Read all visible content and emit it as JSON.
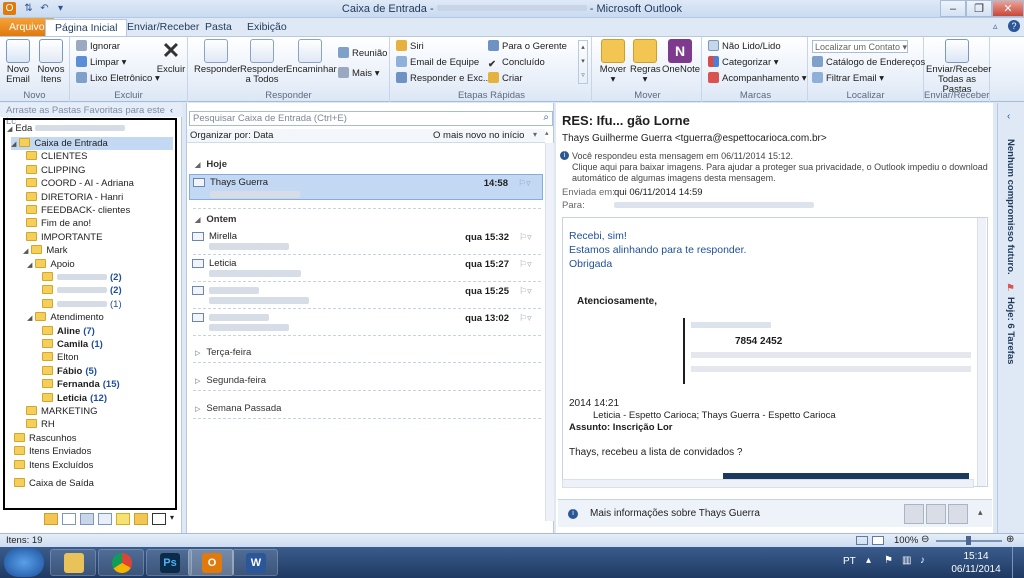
{
  "window": {
    "title_prefix": "Caixa de Entrada - ",
    "title_suffix": " - Microsoft Outlook"
  },
  "tabs": [
    "Arquivo",
    "Página Inicial",
    "Enviar/Receber",
    "Pasta",
    "Exibição"
  ],
  "ribbon": {
    "novo": {
      "label": "Novo",
      "novo_email": "Novo Email",
      "novos_itens": "Novos Itens"
    },
    "excluir": {
      "label": "Excluir",
      "ignorar": "Ignorar",
      "limpar": "Limpar",
      "lixo": "Lixo Eletrônico",
      "excluir_btn": "Excluir"
    },
    "responder": {
      "label": "Responder",
      "responder": "Responder",
      "responder_todos": "Responder a Todos",
      "encaminhar": "Encaminhar",
      "reuniao": "Reunião",
      "mais": "Mais"
    },
    "etapas": {
      "label": "Etapas Rápidas",
      "siri": "Siri",
      "equipe": "Email de Equipe",
      "resp_exc": "Responder e Exc...",
      "para_gerente": "Para o Gerente",
      "concluido": "Concluído",
      "criar": "Criar"
    },
    "mover": {
      "label": "Mover",
      "mover": "Mover",
      "regras": "Regras",
      "onenote": "OneNote"
    },
    "marcas": {
      "label": "Marcas",
      "nao_lido": "Não Lido/Lido",
      "categorizar": "Categorizar",
      "acompanhamento": "Acompanhamento"
    },
    "localizar": {
      "label": "Localizar",
      "contato_placeholder": "Localizar um Contato",
      "catalogo": "Catálogo de Endereços",
      "filtrar": "Filtrar Email"
    },
    "envrec": {
      "label": "Enviar/Receber",
      "btn": "Enviar/Receber Todas as Pastas"
    }
  },
  "nav": {
    "fav_hint": "Arraste as Pastas Favoritas para este Lc",
    "account": "Eda",
    "folders": [
      {
        "name": "Caixa de Entrada",
        "count": "",
        "level": 1,
        "bold": false,
        "selected": true
      },
      {
        "name": "CLIENTES",
        "count": "",
        "level": 2
      },
      {
        "name": "CLIPPING",
        "count": "",
        "level": 2
      },
      {
        "name": "COORD - AI - Adriana",
        "count": "",
        "level": 2
      },
      {
        "name": "DIRETORIA - Hanri",
        "count": "",
        "level": 2
      },
      {
        "name": "FEEDBACK- clientes",
        "count": "",
        "level": 2
      },
      {
        "name": "Fim de ano!",
        "count": "",
        "level": 2
      },
      {
        "name": "IMPORTANTE",
        "count": "",
        "level": 2
      },
      {
        "name": "Mark",
        "count": "",
        "level": 2
      },
      {
        "name": "Apoio",
        "count": "",
        "level": 3
      },
      {
        "name": "",
        "count": "(2)",
        "level": 4,
        "bold": true
      },
      {
        "name": "",
        "count": "(2)",
        "level": 4,
        "bold": true
      },
      {
        "name": "",
        "count": "(1)",
        "level": 4
      },
      {
        "name": "Atendimento",
        "count": "",
        "level": 3
      },
      {
        "name": "Aline",
        "count": "(7)",
        "level": 4,
        "bold": true
      },
      {
        "name": "Camila",
        "count": "(1)",
        "level": 4,
        "bold": true
      },
      {
        "name": "Elton",
        "count": "",
        "level": 4
      },
      {
        "name": "Fábio",
        "count": "(5)",
        "level": 4,
        "bold": true
      },
      {
        "name": "Fernanda",
        "count": "(15)",
        "level": 4,
        "bold": true
      },
      {
        "name": "Leticia",
        "count": "(12)",
        "level": 4,
        "bold": true
      },
      {
        "name": "MARKETING",
        "count": "",
        "level": 2
      },
      {
        "name": "RH",
        "count": "",
        "level": 2
      },
      {
        "name": "Rascunhos",
        "count": "",
        "level": 1
      },
      {
        "name": "Itens Enviados",
        "count": "",
        "level": 1
      },
      {
        "name": "Itens Excluídos",
        "count": "",
        "level": 1
      },
      {
        "name": "Caixa de Saída",
        "count": "",
        "level": 1
      }
    ]
  },
  "list": {
    "search_placeholder": "Pesquisar Caixa de Entrada (Ctrl+E)",
    "sort_label": "Organizar por: Data",
    "order_label": "O mais novo no início",
    "groups": {
      "hoje": "Hoje",
      "ontem": "Ontem",
      "terca": "Terça-feira",
      "segunda": "Segunda-feira",
      "semana": "Semana Passada"
    },
    "messages": [
      {
        "sender": "Thays Guerra",
        "time": "14:58"
      },
      {
        "sender": "Mirella",
        "time": "qua 15:32"
      },
      {
        "sender": "Leticia",
        "time": "qua 15:27"
      },
      {
        "sender": "",
        "time": "qua 15:25"
      },
      {
        "sender": "",
        "time": "qua 13:02"
      }
    ]
  },
  "reading": {
    "subject": "RES: Ifu... gão Lorne",
    "from": "Thays Guilherme Guerra <tguerra@espettocarioca.com.br>",
    "info_line1": "Você respondeu esta mensagem em 06/11/2014 15:12.",
    "info_line2": "Clique aqui para baixar imagens. Para ajudar a proteger sua privacidade, o Outlook impediu o download",
    "info_line3": "automático de algumas imagens desta mensagem.",
    "sent_label": "Enviada em:",
    "sent_value": "qui 06/11/2014 14:59",
    "to_label": "Para:",
    "body": [
      "Recebi, sim!",
      "Estamos alinhando para te responder.",
      "Obrigada"
    ],
    "signoff": "Atenciosamente,",
    "phone_partial": "7854 2452",
    "quote_date": "2014 14:21",
    "quote_from": "Leticia - Espetto Carioca; Thays Guerra - Espetto Carioca",
    "quote_subject": "Assunto: Inscrição Lor",
    "quote_body": "Thays, recebeu a lista de convidados ?",
    "more_info": "Mais informações sobre Thays Guerra"
  },
  "todo": {
    "appt": "Nenhum compromisso futuro.",
    "tasks": "Hoje: 6 Tarefas"
  },
  "status": {
    "items": "Itens: 19",
    "zoom": "100%"
  },
  "taskbar": {
    "lang": "PT",
    "time": "15:14",
    "date": "06/11/2014"
  },
  "colors": {
    "accent": "#2b5797",
    "selection": "#c3d9f3",
    "file_tab": "#e07a0d",
    "link_blue": "#1f4f9b"
  }
}
